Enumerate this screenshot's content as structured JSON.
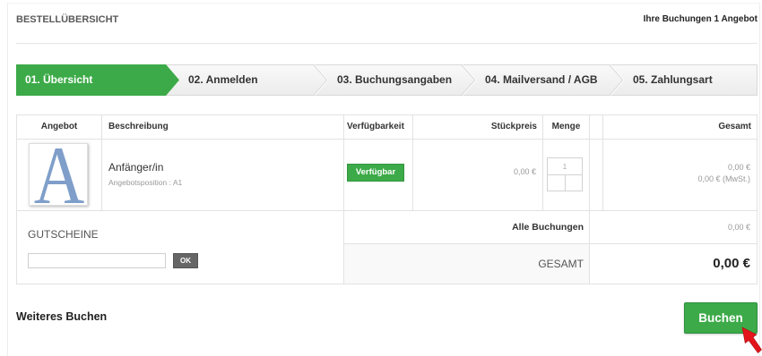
{
  "page": {
    "title": "BESTELLÜBERSICHT",
    "summary": "Ihre Buchungen 1 Angebot"
  },
  "steps": [
    {
      "label": "01. Übersicht",
      "active": true
    },
    {
      "label": "02. Anmelden",
      "active": false
    },
    {
      "label": "03. Buchungsangaben",
      "active": false
    },
    {
      "label": "04. Mailversand / AGB",
      "active": false
    },
    {
      "label": "05. Zahlungsart",
      "active": false
    }
  ],
  "table": {
    "headers": {
      "offer": "Angebot",
      "description": "Beschreibung",
      "availability": "Verfügbarkeit",
      "unit_price": "Stückpreis",
      "quantity": "Menge",
      "total": "Gesamt"
    },
    "rows": [
      {
        "image_letter": "A",
        "title": "Anfänger/in",
        "subtitle": "Angebotsposition : A1",
        "availability": "Verfügbar",
        "unit_price": "0,00 €",
        "quantity": "1",
        "total": "0,00 €",
        "total_vat": "0,00 € (MwSt.)"
      }
    ]
  },
  "vouchers": {
    "title": "GUTSCHEINE",
    "input_value": "",
    "ok_label": "OK"
  },
  "totals": {
    "all_bookings_label": "Alle Buchungen",
    "all_bookings_value": "0,00 €",
    "grand_total_label": "GESAMT",
    "grand_total_value": "0,00 €"
  },
  "footer": {
    "continue_label": "Weiteres Buchen",
    "book_label": "Buchen"
  },
  "colors": {
    "accent": "#3caa48",
    "offer_image_letter": "#7f9fca",
    "cursor": "#e3141b"
  },
  "icons": {
    "pointer": "mouse-cursor-icon"
  }
}
